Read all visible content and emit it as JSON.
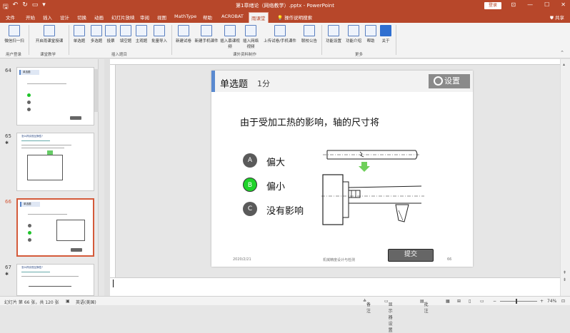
{
  "app": {
    "title": "第1章绪论（网络教学）.pptx - PowerPoint",
    "login_label": "登录",
    "colors": {
      "brand": "#b7472a",
      "selected_option": "#1fd32a",
      "accent_bar": "#5a8ad0"
    }
  },
  "tabs": [
    "文件",
    "开始",
    "插入",
    "设计",
    "切换",
    "动画",
    "幻灯片放映",
    "审阅",
    "视图",
    "MathType",
    "帮助",
    "ACROBAT",
    "雨课堂"
  ],
  "active_tab": "雨课堂",
  "search_label": "操作说明搜索",
  "share_label": "共享",
  "ribbon": {
    "groups": [
      {
        "label": "用户登录",
        "buttons": [
          "微信扫一扫"
        ]
      },
      {
        "label": "课堂教学",
        "buttons": [
          "开启雨课堂授课"
        ]
      },
      {
        "label": "插入题目",
        "buttons": [
          "单选题",
          "多选题",
          "投票",
          "填空题",
          "主观题",
          "批量导入"
        ]
      },
      {
        "label": "课外资料制作",
        "buttons": [
          "新建试卷",
          "新建手机课件",
          "插入慕课视频",
          "插入网络视频",
          "上传试卷/手机课件",
          "联校公告"
        ]
      },
      {
        "label": "更多",
        "buttons": [
          "功能设置",
          "功能介绍",
          "帮助",
          "关于"
        ]
      }
    ]
  },
  "thumbnails": [
    {
      "number": "64",
      "title": "单选题"
    },
    {
      "number": "65",
      "title": "怎么样实现互换性?"
    },
    {
      "number": "66",
      "title": "单选题",
      "selected": true
    },
    {
      "number": "67",
      "title": "怎么样实现互换性?"
    }
  ],
  "slide": {
    "type_label": "单选题",
    "score": "1分",
    "settings_label": "设置",
    "question": "由于受加工热的影响，轴的尺寸将",
    "options": [
      {
        "letter": "A",
        "text": "偏大",
        "selected": false
      },
      {
        "letter": "B",
        "text": "偏小",
        "selected": true
      },
      {
        "letter": "C",
        "text": "没有影响",
        "selected": false
      }
    ],
    "footer_date": "2020/2/21",
    "footer_center": "机械精度设计与检测",
    "page_number": "66",
    "submit_label": "提交"
  },
  "status": {
    "slide_info": "幻灯片 第 66 张，共 120 张",
    "language": "英语(美国)",
    "notes_label": "备注",
    "display_settings": "显示器设置",
    "comments_label": "批注",
    "zoom": "74%"
  }
}
